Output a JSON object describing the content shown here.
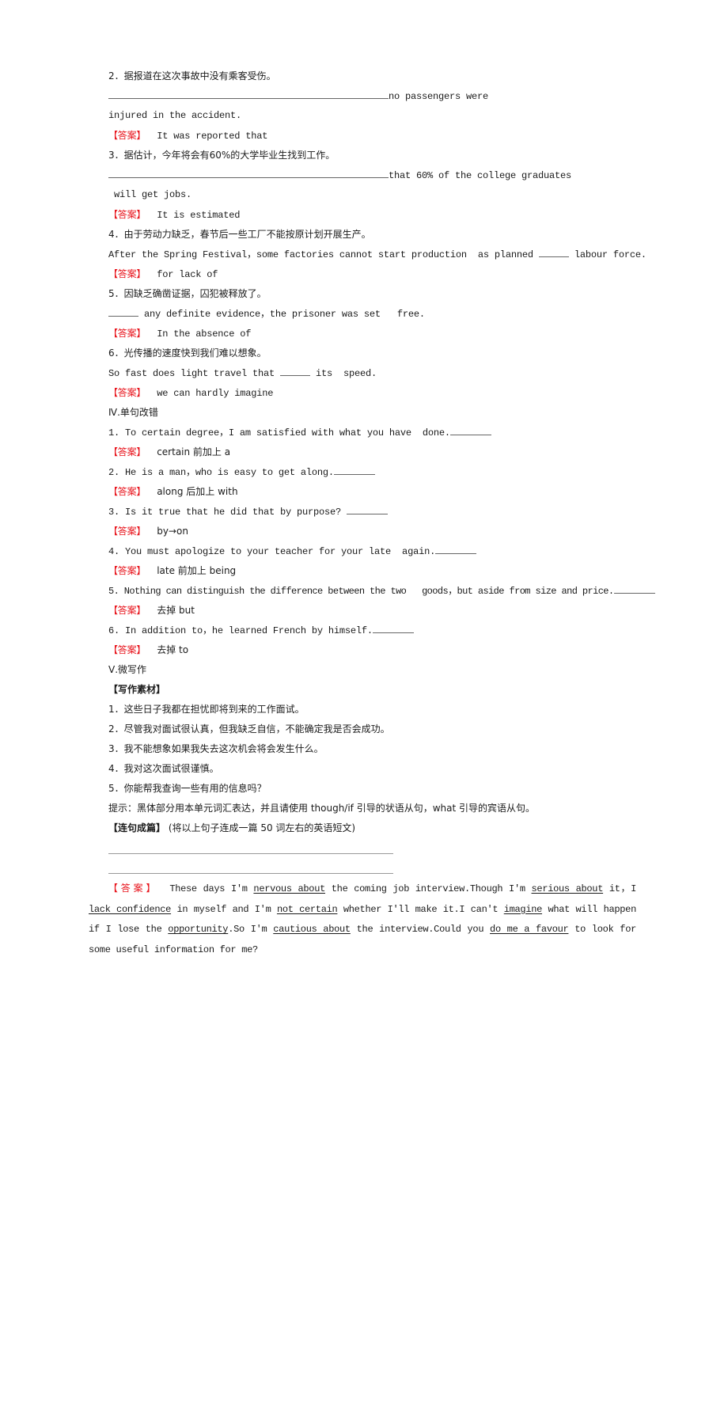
{
  "answer_label": "【答案】",
  "translation_items": [
    {
      "prompt": "2．据报道在这次事故中没有乘客受伤。",
      "line1_suffix": "no passengers were",
      "line2": "injured in the accident.",
      "answer": "It was reported that"
    },
    {
      "prompt": "3．据估计，今年将会有60%的大学毕业生找到工作。",
      "line1_suffix": "that 60% of the college graduates",
      "line2": " will get jobs.",
      "answer": "It is estimated"
    },
    {
      "prompt": "4．由于劳动力缺乏，春节后一些工厂不能按原计划开展生产。",
      "sentence_before": "After the Spring Festival，some factories cannot start production  as planned ",
      "sentence_after": " labour force.",
      "answer": "for lack of"
    },
    {
      "prompt": "5．因缺乏确凿证据，囚犯被释放了。",
      "sentence_before": "",
      "sentence_after": " any definite evidence，the prisoner was set   free.",
      "answer": "In the absence of"
    },
    {
      "prompt": "6．光传播的速度快到我们难以想象。",
      "sentence_before": "So fast does light travel that ",
      "sentence_after": " its  speed.",
      "answer": "we can hardly imagine"
    }
  ],
  "section4": {
    "title": "Ⅳ.单句改错",
    "items": [
      {
        "sentence": "1. To certain degree，I am satisfied with what you have  done.",
        "answer": "certain 前加上 a"
      },
      {
        "sentence": "2. He is a man，who is easy to get along.",
        "answer": "along 后加上 with"
      },
      {
        "sentence": "3. Is it true that he did that by purpose? ",
        "answer": "by→on"
      },
      {
        "sentence": "4. You must apologize to your teacher for your late  again.",
        "answer": "late 前加上 being"
      },
      {
        "sentence": "5. Nothing can distinguish the difference between the two   goods，but aside from size and price.",
        "answer": "去掉 but"
      },
      {
        "sentence": "6. In addition to，he learned French by himself.",
        "answer": "去掉 to"
      }
    ]
  },
  "section5": {
    "title": "Ⅴ.微写作",
    "material_label": "【写作素材】",
    "materials": [
      "1．这些日子我都在担忧即将到来的工作面试。",
      "2．尽管我对面试很认真，但我缺乏自信，不能确定我是否会成功。",
      "3．我不能想象如果我失去这次机会将会发生什么。",
      "4．我对这次面试很谨慎。",
      "5．你能帮我查询一些有用的信息吗？"
    ],
    "hint": "提示：黑体部分用本单元词汇表达，并且请使用 though/if 引导的状语从句，what 引导的宾语从句。",
    "compose_label": "【连句成篇】",
    "compose_instruction": " (将以上句子连成一篇 50 词左右的英语短文)",
    "essay_segments": [
      {
        "t": "These days I'm ",
        "u": false
      },
      {
        "t": "nervous about",
        "u": true
      },
      {
        "t": " the coming job interview.Though I'm ",
        "u": false
      },
      {
        "t": "serious about",
        "u": true
      },
      {
        "t": " it，I ",
        "u": false
      },
      {
        "t": "lack confidence",
        "u": true
      },
      {
        "t": " in myself and I'm ",
        "u": false
      },
      {
        "t": "not certain",
        "u": true
      },
      {
        "t": " whether I'll make it.I can't  ",
        "u": false
      },
      {
        "t": "imagine",
        "u": true
      },
      {
        "t": " what will happen if I lose the ",
        "u": false
      },
      {
        "t": "opportunity",
        "u": true
      },
      {
        "t": ".So I'm  ",
        "u": false
      },
      {
        "t": "cautious about",
        "u": true
      },
      {
        "t": " the interview.Could you ",
        "u": false
      },
      {
        "t": "do me a favour",
        "u": true
      },
      {
        "t": " to  look for some useful information for me?",
        "u": false
      }
    ]
  }
}
